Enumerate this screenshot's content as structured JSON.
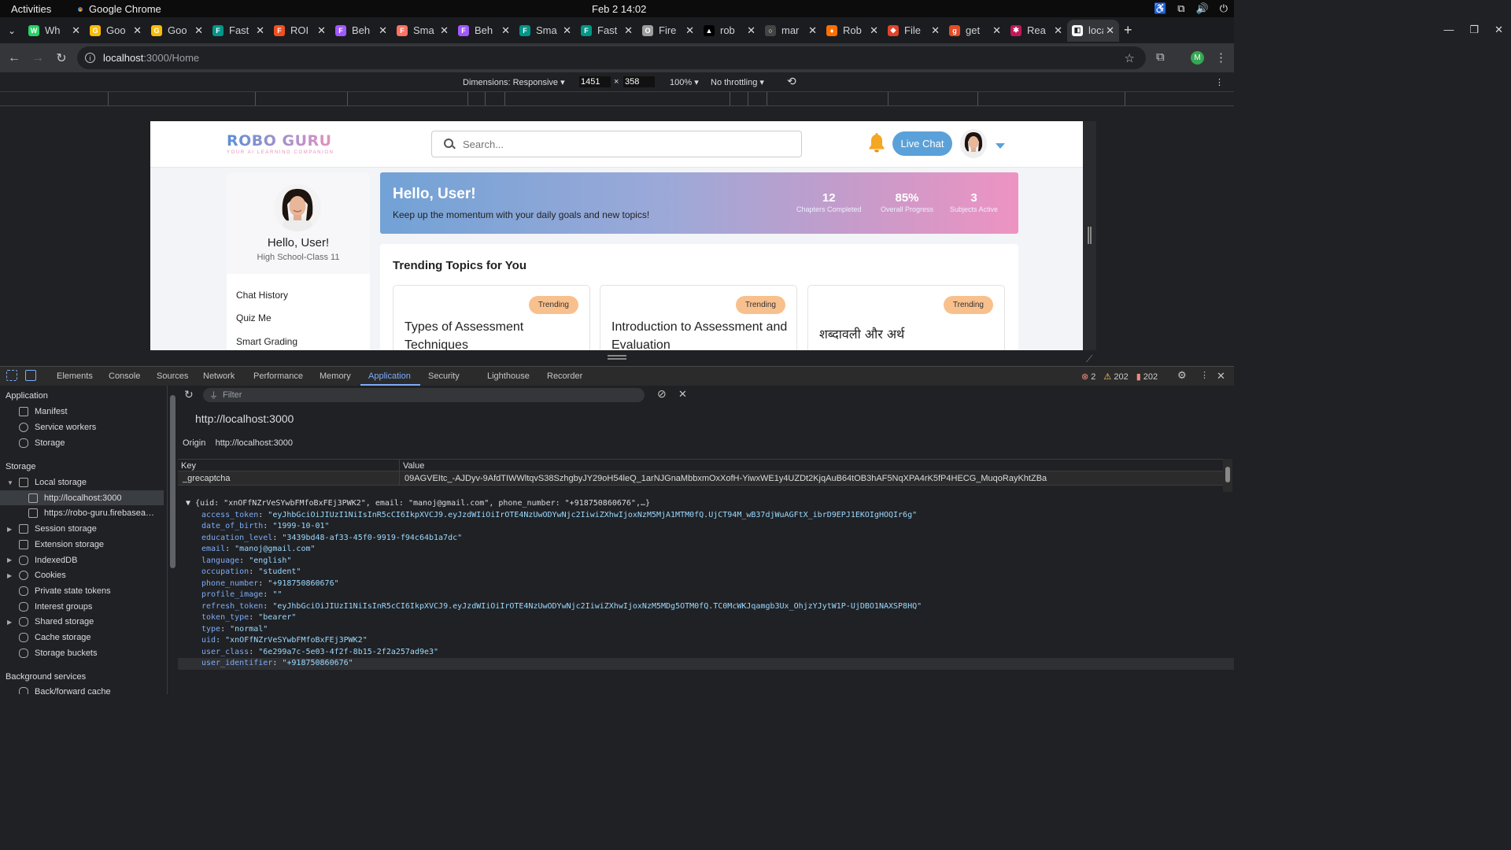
{
  "os_bar": {
    "activities": "Activities",
    "app": "Google Chrome",
    "clock": "Feb 2  14:02"
  },
  "tabs": [
    {
      "label": "Wh",
      "color": "#25d366",
      "glyph": "W"
    },
    {
      "label": "Goo",
      "color": "#fbbc04",
      "glyph": "G"
    },
    {
      "label": "Goo",
      "color": "#fbbc04",
      "glyph": "G"
    },
    {
      "label": "Fast",
      "color": "#009688",
      "glyph": "F"
    },
    {
      "label": "ROI",
      "color": "#f24e1e",
      "glyph": "F"
    },
    {
      "label": "Beh",
      "color": "#a259ff",
      "glyph": "F"
    },
    {
      "label": "Sma",
      "color": "#ff7262",
      "glyph": "F"
    },
    {
      "label": "Beh",
      "color": "#a259ff",
      "glyph": "F"
    },
    {
      "label": "Sma",
      "color": "#009688",
      "glyph": "F"
    },
    {
      "label": "Fast",
      "color": "#009688",
      "glyph": "F"
    },
    {
      "label": "Fire",
      "color": "#9e9e9e",
      "glyph": "O"
    },
    {
      "label": "rob",
      "color": "#000000",
      "glyph": "▲"
    },
    {
      "label": "mar",
      "color": "#444444",
      "glyph": "○"
    },
    {
      "label": "Rob",
      "color": "#ff6f00",
      "glyph": "♦"
    },
    {
      "label": "File",
      "color": "#e24329",
      "glyph": "◆"
    },
    {
      "label": "get",
      "color": "#e44d26",
      "glyph": "g"
    },
    {
      "label": "Rea",
      "color": "#c2185b",
      "glyph": "✱"
    },
    {
      "label": "loca",
      "color": "#ffffff",
      "glyph": "◧",
      "active": true
    }
  ],
  "url": {
    "host": "localhost",
    "path": ":3000/Home"
  },
  "device_toolbar": {
    "dimensions": "Dimensions: Responsive",
    "width": "1451",
    "x": "×",
    "height": "358",
    "zoom": "100%",
    "throttle": "No throttling"
  },
  "app": {
    "logo": "ROBO GURU",
    "tagline": "YOUR AI LEARNING COMPANION",
    "search_placeholder": "Search...",
    "live_chat": "Live Chat",
    "profile_name": "Hello, User!",
    "profile_class": "High School-Class 11",
    "menu": [
      "Chat History",
      "Quiz Me",
      "Smart Grading"
    ],
    "hero_title": "Hello, User!",
    "hero_sub": "Keep up the momentum with your daily goals and new topics!",
    "stats": [
      {
        "value": "12",
        "label": "Chapters Completed"
      },
      {
        "value": "85%",
        "label": "Overall Progress"
      },
      {
        "value": "3",
        "label": "Subjects Active"
      }
    ],
    "trending_title": "Trending Topics for You",
    "cards": [
      {
        "badge": "Trending",
        "title": "Types of Assessment Techniques"
      },
      {
        "badge": "Trending",
        "title": "Introduction to Assessment and Evaluation"
      },
      {
        "badge": "Trending",
        "title": "शब्दावली और अर्थ"
      }
    ]
  },
  "devtools": {
    "tabs": [
      "Elements",
      "Console",
      "Sources",
      "Network",
      "Performance",
      "Memory",
      "Application",
      "Security",
      "Lighthouse",
      "Recorder"
    ],
    "errors": "2",
    "warnings": "202",
    "issues": "202",
    "filter_placeholder": "Filter",
    "origin_url": "http://localhost:3000",
    "origin_label": "Origin",
    "origin_value": "http://localhost:3000",
    "sidebar": {
      "application_header": "Application",
      "application_items": [
        "Manifest",
        "Service workers",
        "Storage"
      ],
      "storage_header": "Storage",
      "local_storage": "Local storage",
      "local_items": [
        "http://localhost:3000",
        "https://robo-guru.firebasea…"
      ],
      "storage_items": [
        "Session storage",
        "Extension storage",
        "IndexedDB",
        "Cookies",
        "Private state tokens",
        "Interest groups",
        "Shared storage",
        "Cache storage",
        "Storage buckets"
      ],
      "background_header": "Background services",
      "background_items": [
        "Back/forward cache"
      ]
    },
    "table": {
      "key_header": "Key",
      "value_header": "Value",
      "row_key": "_grecaptcha",
      "row_value": "09AGVEItc_-AJDyv-9AfdTIWWltqvS38SzhgbyJY29oH54leQ_1arNJGnaMbbxmOxXofH-YiwxWE1y4UZDt2KjqAuB64tOB3hAF5NqXPA4rK5fP4HECG_MuqoRayKhtZBa"
    },
    "json_summary": "{uid: \"xnOFfNZrVeSYwbFMfoBxFEj3PWK2\", email: \"manoj@gmail.com\", phone_number: \"+918750860676\",…}",
    "json_fields": [
      {
        "k": "access_token",
        "v": "\"eyJhbGciOiJIUzI1NiIsInR5cCI6IkpXVCJ9.eyJzdWIiOiIrOTE4NzUwODYwNjc2IiwiZXhwIjoxNzM5MjA1MTM0fQ.UjCT94M_wB37djWuAGFtX_ibrD9EPJ1EKOIgHOQIr6g\""
      },
      {
        "k": "date_of_birth",
        "v": "\"1999-10-01\""
      },
      {
        "k": "education_level",
        "v": "\"3439bd48-af33-45f0-9919-f94c64b1a7dc\""
      },
      {
        "k": "email",
        "v": "\"manoj@gmail.com\""
      },
      {
        "k": "language",
        "v": "\"english\""
      },
      {
        "k": "occupation",
        "v": "\"student\""
      },
      {
        "k": "phone_number",
        "v": "\"+918750860676\""
      },
      {
        "k": "profile_image",
        "v": "\"\""
      },
      {
        "k": "refresh_token",
        "v": "\"eyJhbGciOiJIUzI1NiIsInR5cCI6IkpXVCJ9.eyJzdWIiOiIrOTE4NzUwODYwNjc2IiwiZXhwIjoxNzM5MDg5OTM0fQ.TC0McWKJqamgb3Ux_OhjzYJytW1P-UjDBO1NAXSP8HQ\""
      },
      {
        "k": "token_type",
        "v": "\"bearer\""
      },
      {
        "k": "type",
        "v": "\"normal\""
      },
      {
        "k": "uid",
        "v": "\"xnOFfNZrVeSYwbFMfoBxFEj3PWK2\""
      },
      {
        "k": "user_class",
        "v": "\"6e299a7c-5e03-4f2f-8b15-2f2a257ad9e3\""
      },
      {
        "k": "user_identifier",
        "v": "\"+918750860676\""
      }
    ]
  }
}
